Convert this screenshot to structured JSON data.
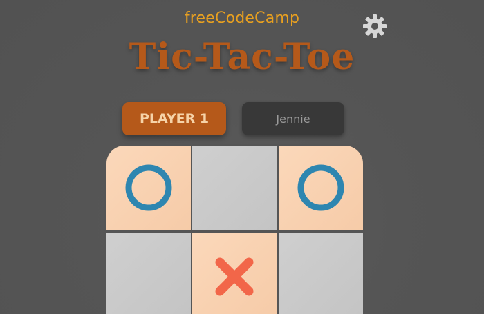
{
  "header": {
    "brand": "freeCodeCamp",
    "title": "Tic-Tac-Toe",
    "settings_icon": "gear-icon"
  },
  "players": {
    "player1_label": "PLAYER 1",
    "player2_label": "Jennie",
    "active": "player1"
  },
  "board": {
    "cells": [
      [
        "O",
        "",
        "O"
      ],
      [
        "",
        "X",
        ""
      ],
      [
        "",
        "",
        ""
      ]
    ]
  },
  "colors": {
    "background": "#555555",
    "brand": "#e8a020",
    "title": "#b5591a",
    "active_player": "#b5591a",
    "inactive_player": "#383838",
    "o_mark": "#2e86b0",
    "x_mark": "#f26649",
    "filled_cell": "#f9d2b3",
    "empty_cell": "#c9c9c9"
  }
}
